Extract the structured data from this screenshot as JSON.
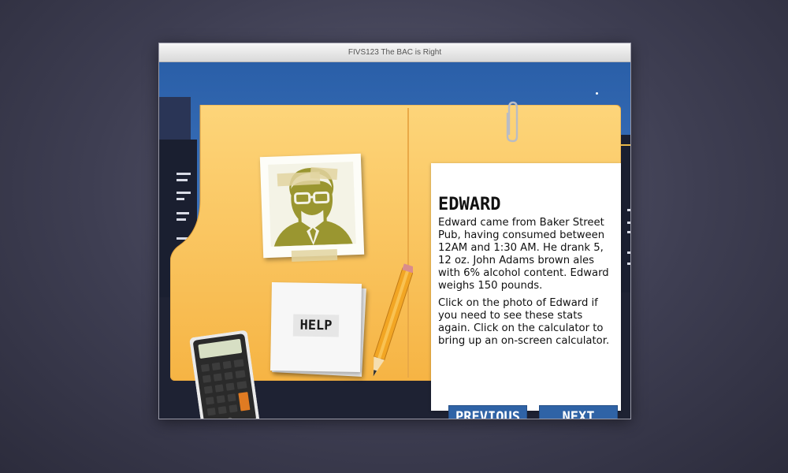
{
  "window": {
    "title": "FIVS123 The BAC is Right"
  },
  "profile": {
    "name": "EDWARD",
    "paragraphs": [
      "Edward came from Baker Street Pub, having consumed between 12AM and 1:30 AM. He drank 5, 12 oz. John Adams brown ales with 6% alcohol content. Edward weighs 150 pounds.",
      "Click on the photo of Edward if you need to see these stats again. Click on the calculator to bring up an on-screen calculator."
    ]
  },
  "help": {
    "label": "HELP"
  },
  "navigation": {
    "previous_label": "PREVIOUS",
    "next_label": "NEXT"
  },
  "icons": {
    "photo": "person-silhouette-icon",
    "calculator": "calculator-icon",
    "pencil": "pencil-icon",
    "paperclip": "paperclip-icon"
  },
  "colors": {
    "folder": "#fbc35a",
    "button": "#2f63a6",
    "sky": "#3a6db6",
    "photo_figure": "#9a9630"
  }
}
